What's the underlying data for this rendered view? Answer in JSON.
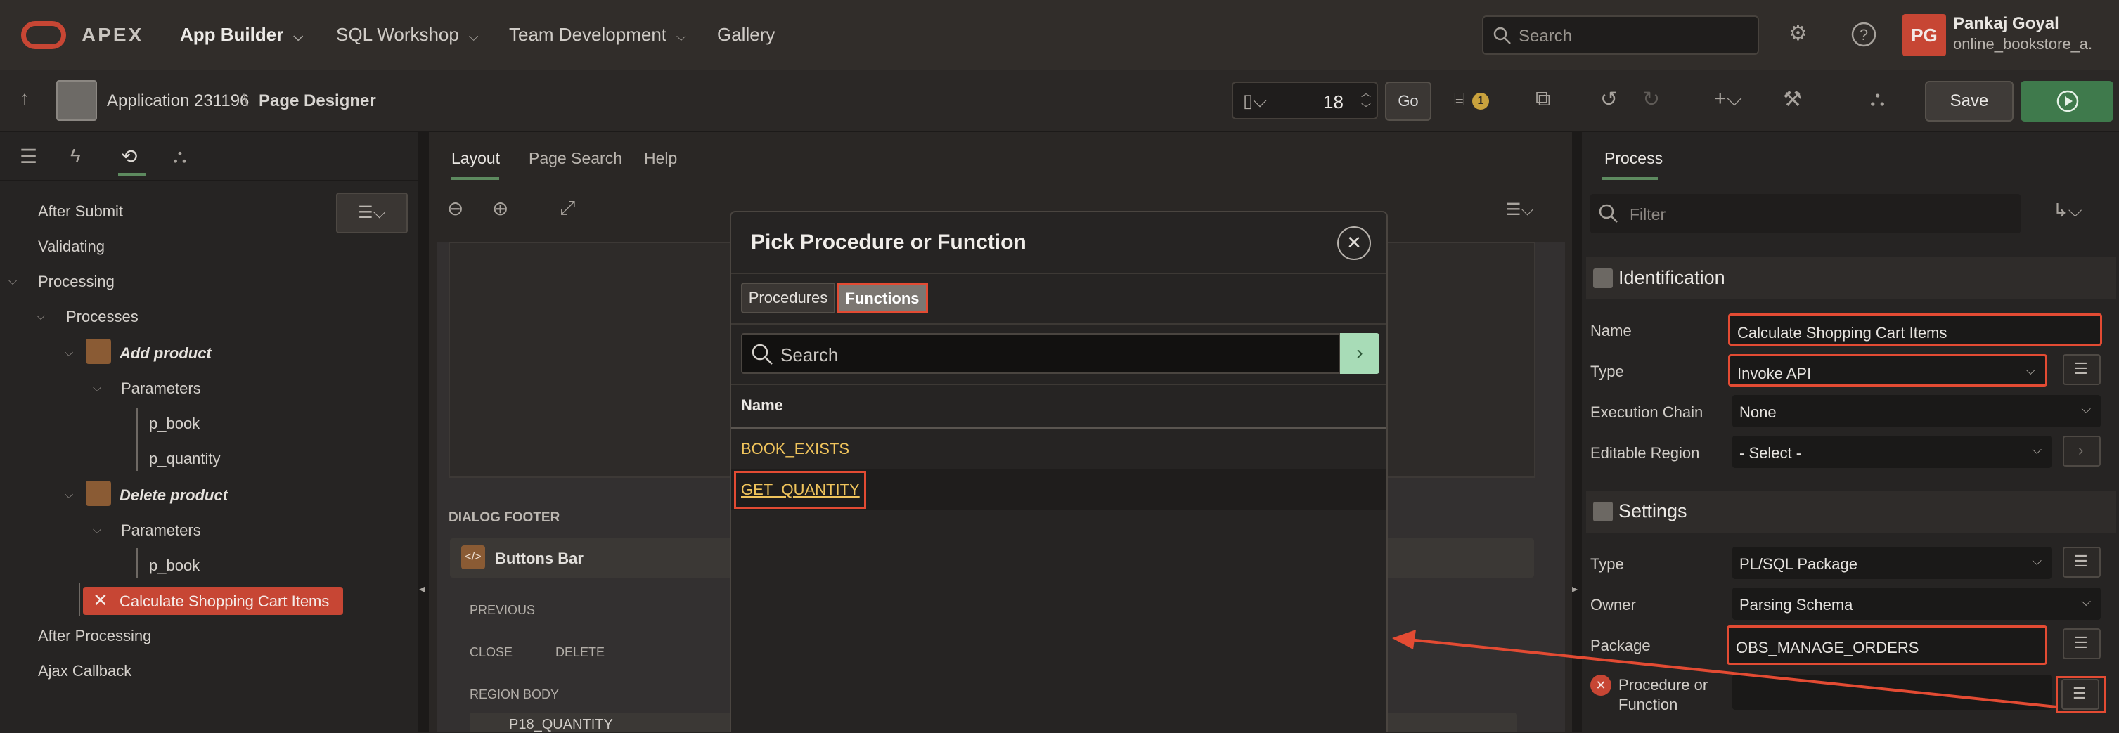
{
  "top_nav": {
    "brand": "APEX",
    "items": [
      "App Builder",
      "SQL Workshop",
      "Team Development",
      "Gallery"
    ],
    "search_placeholder": "Search",
    "user_initials": "PG",
    "user_name": "Pankaj Goyal",
    "user_workspace": "online_bookstore_a..."
  },
  "toolbar": {
    "application": "Application 231196",
    "breadcrumb_sep": "\\",
    "page_designer": "Page Designer",
    "page_number": "18",
    "go_label": "Go",
    "issues_count": "1",
    "save_label": "Save"
  },
  "left_tree": {
    "after_submit": "After Submit",
    "validating": "Validating",
    "processing": "Processing",
    "processes": "Processes",
    "add_product": "Add product",
    "parameters_1": "Parameters",
    "p_book_1": "p_book",
    "p_quantity": "p_quantity",
    "delete_product": "Delete product",
    "parameters_2": "Parameters",
    "p_book_2": "p_book",
    "selected": "Calculate Shopping Cart Items",
    "after_processing": "After Processing",
    "ajax_callback": "Ajax Callback"
  },
  "center": {
    "tabs": [
      "Layout",
      "Page Search",
      "Help"
    ],
    "dialog_footer": "DIALOG FOOTER",
    "buttons_bar": "Buttons Bar",
    "previous": "PREVIOUS",
    "close": "CLOSE",
    "delete": "DELETE",
    "region_body": "REGION BODY",
    "item": "P18_QUANTITY"
  },
  "dialog": {
    "title": "Pick Procedure or Function",
    "tab_procedures": "Procedures",
    "tab_functions": "Functions",
    "search_placeholder": "Search",
    "column_name": "Name",
    "rows": [
      "BOOK_EXISTS",
      "GET_QUANTITY"
    ]
  },
  "right_pane": {
    "tab": "Process",
    "filter_placeholder": "Filter",
    "identification": "Identification",
    "name_label": "Name",
    "name_value": "Calculate Shopping Cart Items",
    "type_label": "Type",
    "type_value": "Invoke API",
    "chain_label": "Execution Chain",
    "chain_value": "None",
    "editable_label": "Editable Region",
    "editable_value": "- Select -",
    "settings": "Settings",
    "settings_type_label": "Type",
    "settings_type_value": "PL/SQL Package",
    "owner_label": "Owner",
    "owner_value": "Parsing Schema",
    "package_label": "Package",
    "package_value": "OBS_MANAGE_ORDERS",
    "proc_label_1": "Procedure or",
    "proc_label_2": "Function"
  },
  "colors": {
    "accent_red": "#e34b33",
    "brand_red": "#c74634",
    "link_yellow": "#f0c45c",
    "run_green": "#3f7a4c"
  }
}
